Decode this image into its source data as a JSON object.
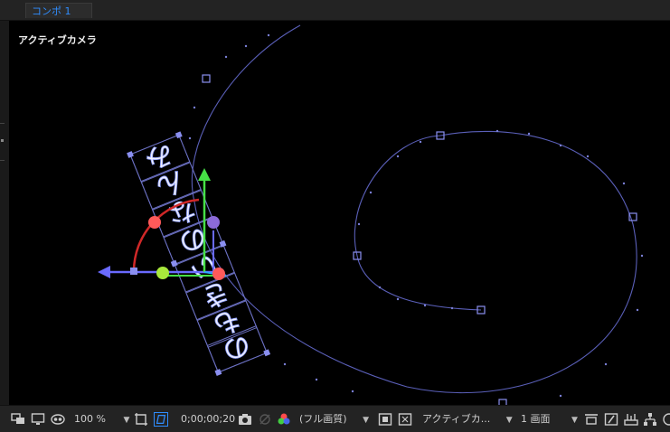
{
  "tab": {
    "label": "コンポ 1"
  },
  "viewer": {
    "camera_label": "アクティブカメラ"
  },
  "text_layer": {
    "glyphs": [
      "み",
      "ん",
      "な",
      "の",
      "い",
      "き",
      "も",
      "の"
    ]
  },
  "toolbar": {
    "zoom": "100 %",
    "timecode": "0;00;00;20",
    "resolution": "(フル画質)",
    "view": "アクティブカ...",
    "layout": "1 画面"
  },
  "colors": {
    "path": "#7a7fd6",
    "axis_x": "#ff4b4b",
    "axis_y": "#46e046",
    "axis_z": "#6a6aff",
    "tab_text": "#2f8dff"
  }
}
